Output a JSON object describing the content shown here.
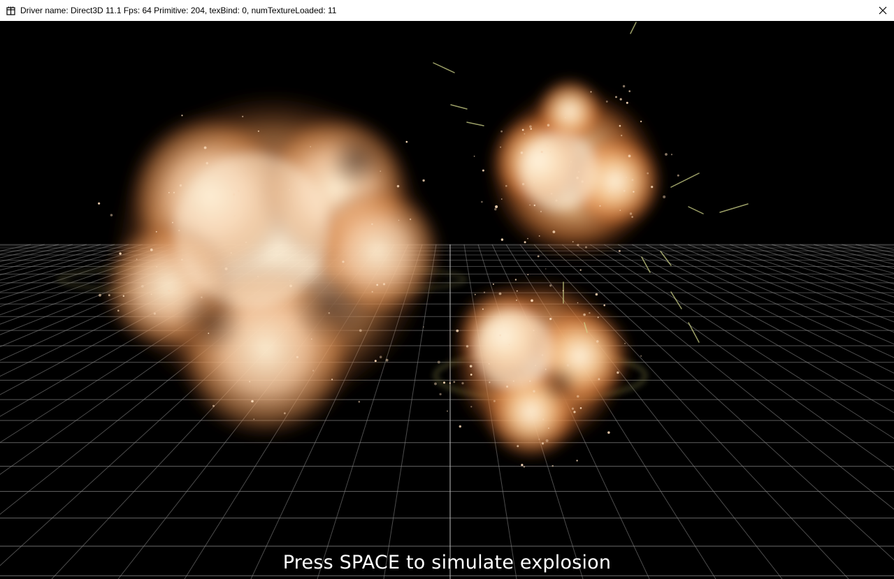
{
  "window": {
    "title": "Driver name: Direct3D 11.1 Fps: 64 Primitive: 204, texBind: 0, numTextureLoaded: 11",
    "icon": "app-icon",
    "close_icon": "close-icon"
  },
  "scene": {
    "background_color": "#000000",
    "grid_color": "#8a8a8a",
    "explosion_colors": {
      "core": "#fff1d6",
      "mid": "#f4b078",
      "edge": "#c8662e"
    },
    "hint": "Press SPACE to simulate explosion"
  }
}
